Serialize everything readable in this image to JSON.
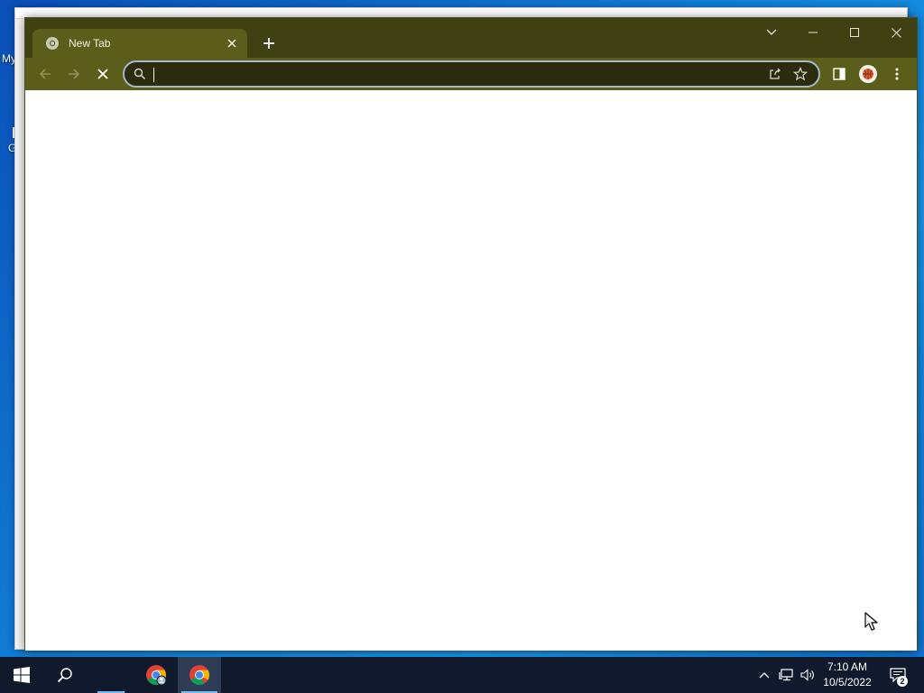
{
  "desktop": {
    "icon_labels": [
      "My",
      "G"
    ]
  },
  "browser": {
    "tab": {
      "title": "New Tab"
    },
    "omnibox": {
      "value": "",
      "placeholder": ""
    },
    "colors": {
      "frame": "#3f4113",
      "toolbar": "#5b5e1b",
      "omnibox_bg": "#2b2c0d",
      "omnibox_focus_ring": "#a6b7c9"
    },
    "icons": {
      "tab_favicon": "chrome-newtab-icon",
      "tab_close": "close-icon",
      "new_tab": "plus-icon",
      "tab_search": "chevron-down-icon",
      "minimize": "minimize-icon",
      "maximize": "maximize-icon",
      "close_window": "close-icon",
      "back": "arrow-left-icon",
      "forward": "arrow-right-icon",
      "stop": "stop-icon",
      "search": "search-icon",
      "share": "share-icon",
      "bookmark": "star-icon",
      "side_panel": "side-panel-icon",
      "profile": "avatar",
      "menu": "kebab-menu-icon"
    }
  },
  "taskbar": {
    "clock": {
      "time": "7:10 AM",
      "date": "10/5/2022"
    },
    "notifications": {
      "count": "2"
    },
    "icons": [
      "windows-start-icon",
      "search-icon",
      "chrome-icon",
      "chrome-icon"
    ]
  }
}
